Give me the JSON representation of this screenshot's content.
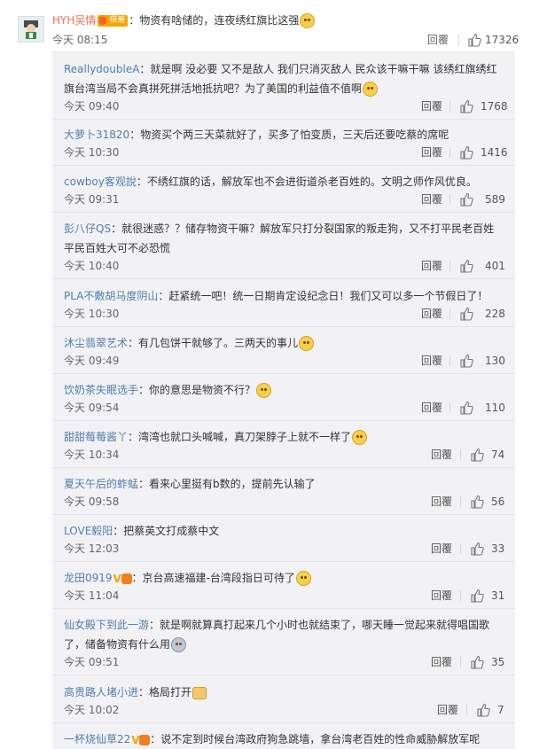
{
  "main_comment": {
    "user": "HYH吴情",
    "badge": "获册",
    "text": "：物资有啥储的，连夜绣红旗比这强",
    "time": "今天 08:15",
    "reply_label": "回覆",
    "likes": "17326"
  },
  "sub_comments": [
    {
      "user": "ReallydoubleA",
      "text": "：就是啊 没必要 又不是敌人 我们只消灭敌人 民众该干嘛干嘛 该绣红旗绣红旗台湾当局不会真拼死拼活地抵抗吧？为了美国的利益值不值啊",
      "emoji": "cat-emoji",
      "time": "今天 09:40",
      "reply": "回覆",
      "likes": "1768"
    },
    {
      "user": "大萝卜31820",
      "text": "：物资买个两三天菜就好了，买多了怕变质，三天后还要吃蔡的席呢",
      "time": "今天 10:30",
      "reply": "回覆",
      "likes": "1416"
    },
    {
      "user": "cowboy客观說",
      "text": "：不绣红旗的话，解放军也不会进街道杀老百姓的。文明之师作风优良。",
      "time": "今天 09:31",
      "reply": "回覆",
      "likes": "589"
    },
    {
      "user": "彭八仔QS",
      "text": "：就很迷惑？？储存物资干嘛？解放军只打分裂国家的叛走狗，又不打平民老百姓　平民百姓大可不必恐慌",
      "time": "今天 10:40",
      "reply": "回覆",
      "likes": "401"
    },
    {
      "user": "PLA不敷胡马度阴山",
      "text": "：赶紧统一吧！统一日期肯定设纪念日！我们又可以多一个节假日了！",
      "time": "今天 10:30",
      "reply": "回覆",
      "likes": "228"
    },
    {
      "user": "沐尘翡翠艺术",
      "text": "：有几包饼干就够了。三两天的事儿",
      "emoji": "cat-emoji",
      "time": "今天 09:49",
      "reply": "回覆",
      "likes": "130"
    },
    {
      "user": "饮奶茶失眠选手",
      "text": "：你的意思是物资不行？",
      "emoji": "cat-emoji",
      "time": "今天 09:54",
      "reply": "回覆",
      "likes": "110"
    },
    {
      "user": "甜甜莓莓酱丫",
      "text": "：湾湾也就口头喊喊，真刀架脖子上就不一样了",
      "emoji": "cat-emoji",
      "time": "今天 10:34",
      "reply": "回覆",
      "likes": "74"
    },
    {
      "user": "夏天午后的蚱蜢",
      "text": "：看来心里挺有b数的，提前先认输了",
      "time": "今天 09:58",
      "reply": "回覆",
      "likes": "56"
    },
    {
      "user": "LOVE毅阳",
      "text": "：把蔡英文打成蔡中文",
      "time": "今天 12:03",
      "reply": "回覆",
      "likes": "33"
    },
    {
      "user": "龙田0919",
      "text": "：京台高速福建-台湾段指日可待了",
      "emoji": "cat-emoji",
      "time": "今天 11:04",
      "reply": "回覆",
      "likes": "31"
    },
    {
      "user": "仙女殿下到此一游",
      "text": "：就是啊就算真打起来几个小时也就结束了，哪天睡一觉起来就得唱国歌了，储备物资有什么用",
      "emoji": "sad-emoji",
      "time": "今天 09:51",
      "reply": "回覆",
      "likes": "35"
    },
    {
      "user": "高贵路人堵小进",
      "text": "：格局打开",
      "emoji": "thumb-emoji",
      "time": "今天 10:02",
      "reply": "回覆",
      "likes": "7"
    },
    {
      "user": "一杯烧仙草22",
      "text": "：说不定到时候台湾政府狗急跳墙，拿台湾老百姓的性命威胁解放军呢"
    }
  ],
  "colors": {
    "username_main": "#eb7350",
    "username_reply": "#507daf",
    "sub_bg": "#f2f2f5"
  },
  "icons": {
    "like": "thumb-up-icon"
  }
}
